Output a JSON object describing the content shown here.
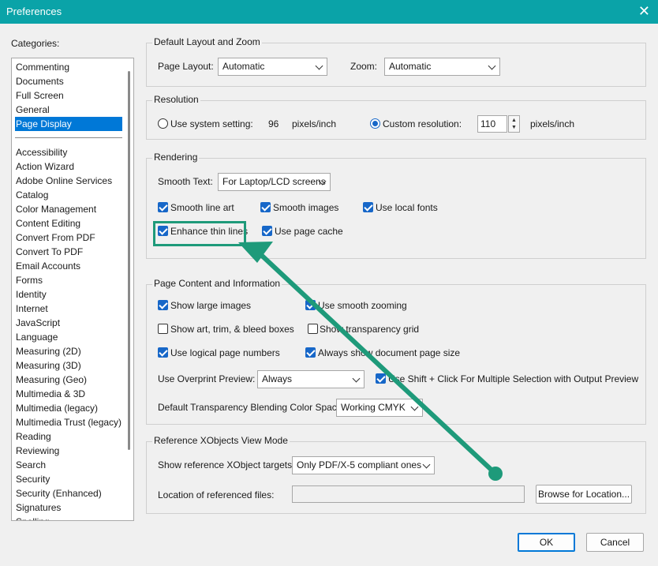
{
  "window": {
    "title": "Preferences",
    "close_glyph": "✕"
  },
  "categories": {
    "label": "Categories:",
    "top_items": [
      "Commenting",
      "Documents",
      "Full Screen",
      "General",
      "Page Display"
    ],
    "selected": "Page Display",
    "items": [
      "Accessibility",
      "Action Wizard",
      "Adobe Online Services",
      "Catalog",
      "Color Management",
      "Content Editing",
      "Convert From PDF",
      "Convert To PDF",
      "Email Accounts",
      "Forms",
      "Identity",
      "Internet",
      "JavaScript",
      "Language",
      "Measuring (2D)",
      "Measuring (3D)",
      "Measuring (Geo)",
      "Multimedia & 3D",
      "Multimedia (legacy)",
      "Multimedia Trust (legacy)",
      "Reading",
      "Reviewing",
      "Search",
      "Security",
      "Security (Enhanced)",
      "Signatures",
      "Spelling"
    ]
  },
  "layout_zoom": {
    "legend": "Default Layout and Zoom",
    "page_layout_label": "Page Layout:",
    "page_layout_value": "Automatic",
    "zoom_label": "Zoom:",
    "zoom_value": "Automatic"
  },
  "resolution": {
    "legend": "Resolution",
    "system_setting_label": "Use system setting:",
    "system_value": "96",
    "system_units": "pixels/inch",
    "custom_label": "Custom resolution:",
    "custom_value": "110",
    "custom_units": "pixels/inch",
    "selected": "custom"
  },
  "rendering": {
    "legend": "Rendering",
    "smooth_text_label": "Smooth Text:",
    "smooth_text_value": "For Laptop/LCD screens",
    "smooth_line_art": {
      "label": "Smooth line art",
      "checked": true
    },
    "smooth_images": {
      "label": "Smooth images",
      "checked": true
    },
    "use_local_fonts": {
      "label": "Use local fonts",
      "checked": true
    },
    "enhance_thin_lines": {
      "label": "Enhance thin lines",
      "checked": true
    },
    "use_page_cache": {
      "label": "Use page cache",
      "checked": true
    }
  },
  "page_content": {
    "legend": "Page Content and Information",
    "show_large_images": {
      "label": "Show large images",
      "checked": true
    },
    "use_smooth_zooming": {
      "label": "Use smooth zooming",
      "checked": true
    },
    "show_art_trim": {
      "label": "Show art, trim, & bleed boxes",
      "checked": false
    },
    "show_transparency_grid": {
      "label": "Show transparency grid",
      "checked": false
    },
    "use_logical_page_numbers": {
      "label": "Use logical page numbers",
      "checked": true
    },
    "always_show_page_size": {
      "label": "Always show document page size",
      "checked": true
    },
    "overprint_label": "Use Overprint Preview:",
    "overprint_value": "Always",
    "shift_click": {
      "label": "Use Shift + Click For Multiple Selection with Output Preview",
      "checked": true
    },
    "blending_label": "Default Transparency Blending Color Space:",
    "blending_value": "Working CMYK"
  },
  "xobjects": {
    "legend": "Reference XObjects View Mode",
    "targets_label": "Show reference XObject targets:",
    "targets_value": "Only PDF/X-5 compliant ones",
    "location_label": "Location of referenced files:",
    "location_value": "",
    "browse_label": "Browse for Location..."
  },
  "footer": {
    "ok_label": "OK",
    "cancel_label": "Cancel"
  },
  "annotation": {
    "color": "#1e9a7a"
  }
}
